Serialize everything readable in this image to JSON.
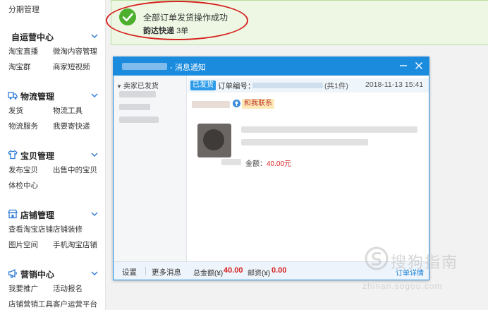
{
  "sidebar": {
    "top_item": "分期管理",
    "sections": [
      {
        "title": "自运营中心",
        "icon": "",
        "items": [
          [
            "淘宝直播",
            "微淘内容管理"
          ],
          [
            "淘宝群",
            "商家短视频"
          ]
        ]
      },
      {
        "title": "物流管理",
        "icon": "truck-icon",
        "items": [
          [
            "发货",
            "物流工具"
          ],
          [
            "物流服务",
            "我要寄快递"
          ]
        ]
      },
      {
        "title": "宝贝管理",
        "icon": "shirt-icon",
        "items": [
          [
            "发布宝贝",
            "出售中的宝贝"
          ],
          [
            "体检中心",
            ""
          ]
        ]
      },
      {
        "title": "店铺管理",
        "icon": "store-icon",
        "items": [
          [
            "查看淘宝店铺",
            "店铺装修"
          ],
          [
            "图片空间",
            "手机淘宝店铺"
          ]
        ]
      },
      {
        "title": "营销中心",
        "icon": "megaphone-icon",
        "items": [
          [
            "我要推广",
            "活动报名"
          ],
          [
            "店铺营销工具",
            "客户运营平台"
          ]
        ]
      }
    ]
  },
  "banner": {
    "line1": "全部订单发货操作成功",
    "carrier": "韵达快递",
    "count": "3单"
  },
  "popup": {
    "title": "- 消息通知",
    "sidebar_header": "卖家已发货",
    "status_badge": "已发货",
    "order_label": "订单编号：",
    "order_count": "(共1件)",
    "order_time": "2018-11-13 15:41",
    "contact_label": "和我联系",
    "amount_label": "金额：",
    "amount_value": "40.00元",
    "footer": {
      "settings": "设置",
      "more": "更多消息",
      "total_label": "总金额(¥)",
      "total_value": "40.00",
      "shipping_label": "邮资(¥)",
      "shipping_value": "0.00",
      "detail_link": "订单详情"
    }
  },
  "watermark": {
    "text": "搜狗指南",
    "url": "zhinan.sogou.com"
  },
  "colors": {
    "accent_blue": "#1b8bde",
    "success_green": "#4caf2e",
    "price_red": "#d62222",
    "annotation_red": "#d6231e"
  }
}
